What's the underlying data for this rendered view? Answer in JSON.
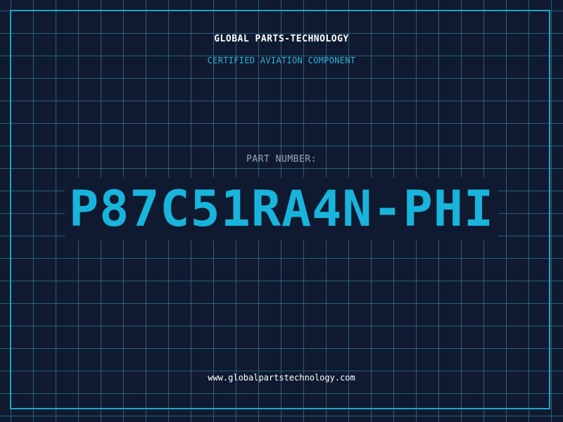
{
  "header": {
    "company": "GLOBAL PARTS-TECHNOLOGY",
    "certification": "CERTIFIED AVIATION COMPONENT"
  },
  "part": {
    "label": "PART NUMBER:",
    "number": "P87C51RA4N-PHI"
  },
  "footer": {
    "url": "www.globalpartstechnology.com"
  },
  "colors": {
    "background": "#0f1a30",
    "grid": "#4096aa",
    "accent": "#18b4dc",
    "text": "#ffffff",
    "muted": "#9aa8b8"
  }
}
